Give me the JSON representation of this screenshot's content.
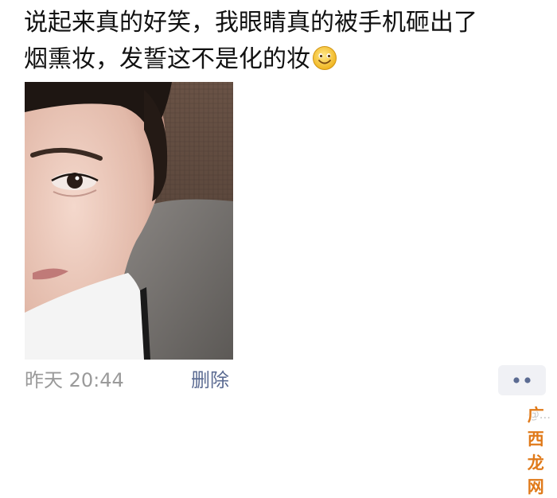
{
  "post": {
    "text_line1": "说起来真的好笑，我眼睛真的被手机砸出了",
    "text_line2": "烟熏妆，发誓这不是化的妆",
    "emoji": "smile-emoji"
  },
  "meta": {
    "time": "昨天 20:44",
    "delete_label": "删除"
  },
  "more_button": {
    "icon": "two-dots-icon"
  },
  "watermark": {
    "handle": "@...",
    "brand": "广西龙网"
  },
  "colors": {
    "link": "#5b6b92",
    "meta": "#9a9a9a",
    "brand": "#e07a1a"
  }
}
